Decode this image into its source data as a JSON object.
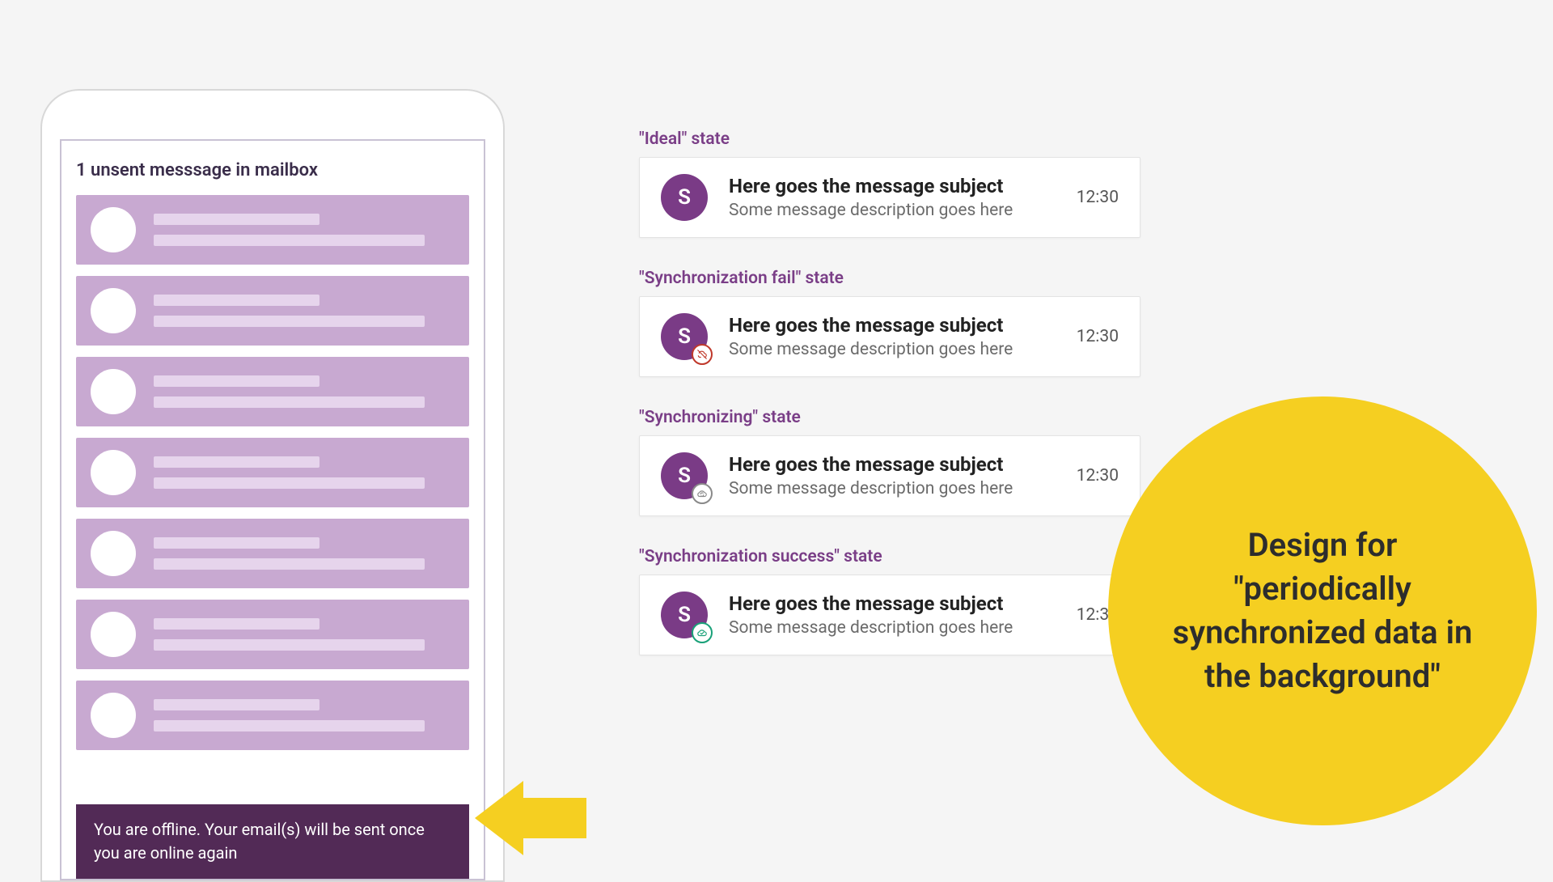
{
  "phone": {
    "unsent_label": "1 unsent messsage in mailbox",
    "toast": "You are offline. Your email(s) will be sent once you are online again"
  },
  "states": [
    {
      "label": "\"Ideal\" state",
      "id": "ideal",
      "badge": null,
      "avatar_initial": "S",
      "subject": "Here goes the message subject",
      "desc": "Some message description goes here",
      "time": "12:30"
    },
    {
      "label": "\"Synchronization fail\" state",
      "id": "sync-fail",
      "badge": "fail",
      "avatar_initial": "S",
      "subject": "Here goes the message subject",
      "desc": "Some message description goes here",
      "time": "12:30"
    },
    {
      "label": "\"Synchronizing\" state",
      "id": "syncing",
      "badge": "sync",
      "avatar_initial": "S",
      "subject": "Here goes the message subject",
      "desc": "Some message description goes here",
      "time": "12:30"
    },
    {
      "label": "\"Synchronization success\" state",
      "id": "sync-success",
      "badge": "success",
      "avatar_initial": "S",
      "subject": "Here goes the message subject",
      "desc": "Some message description goes here",
      "time": "12:30"
    }
  ],
  "callout": {
    "text": "Design for \"periodically synchronized data in the background\""
  },
  "colors": {
    "purple": "#7a3b86",
    "purple_dark": "#522a56",
    "lavender": "#c8a9d1",
    "yellow": "#f5cf21",
    "fail": "#c0392b",
    "sync": "#8a8a8a",
    "success": "#1aa179"
  }
}
